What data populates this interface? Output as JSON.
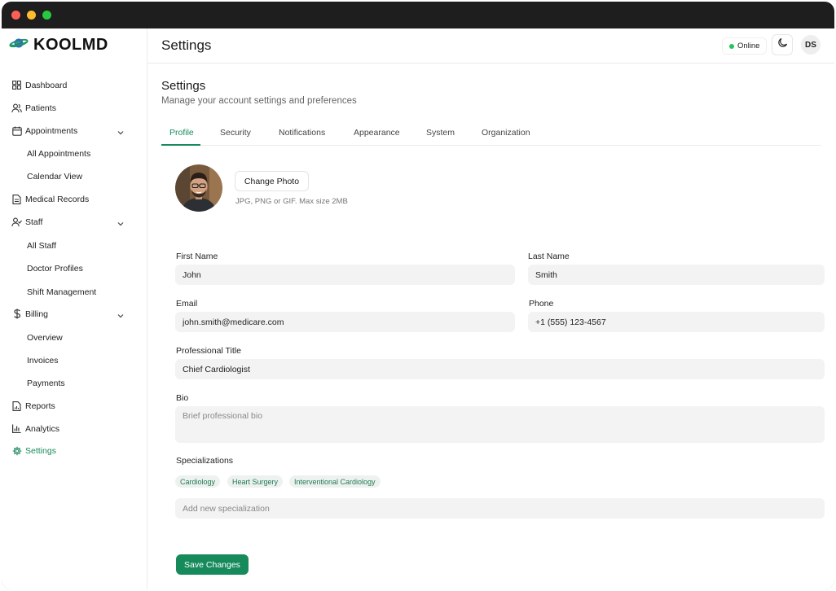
{
  "brand": {
    "name": "KOOLMD",
    "logo_icon": "planet-icon"
  },
  "sidebar": {
    "items": [
      {
        "label": "Dashboard",
        "icon": "grid-icon"
      },
      {
        "label": "Patients",
        "icon": "users-icon"
      },
      {
        "label": "Appointments",
        "icon": "calendar-icon"
      },
      {
        "label": "All Appointments"
      },
      {
        "label": "Calendar View"
      },
      {
        "label": "Medical Records",
        "icon": "document-icon"
      },
      {
        "label": "Staff",
        "icon": "user-check-icon"
      },
      {
        "label": "All Staff"
      },
      {
        "label": "Doctor Profiles"
      },
      {
        "label": "Shift Management"
      },
      {
        "label": "Billing",
        "icon": "dollar-icon"
      },
      {
        "label": "Overview"
      },
      {
        "label": "Invoices"
      },
      {
        "label": "Payments"
      },
      {
        "label": "Reports",
        "icon": "report-icon"
      },
      {
        "label": "Analytics",
        "icon": "bar-chart-icon"
      },
      {
        "label": "Settings",
        "icon": "gear-icon"
      }
    ]
  },
  "header": {
    "title": "Settings",
    "status": "Online",
    "user_initials": "DS"
  },
  "page": {
    "title": "Settings",
    "subtitle": "Manage your account settings and preferences",
    "tabs": [
      "Profile",
      "Security",
      "Notifications",
      "Appearance",
      "System",
      "Organization"
    ],
    "active_tab": "Profile"
  },
  "profile": {
    "change_photo_label": "Change Photo",
    "photo_hint": "JPG, PNG or GIF. Max size 2MB",
    "first_name_label": "First Name",
    "first_name": "John",
    "last_name_label": "Last Name",
    "last_name": "Smith",
    "email_label": "Email",
    "email": "john.smith@medicare.com",
    "phone_label": "Phone",
    "phone": "+1 (555) 123-4567",
    "title_label": "Professional Title",
    "title": "Chief Cardiologist",
    "bio_label": "Bio",
    "bio_placeholder": "Brief professional bio",
    "specializations_label": "Specializations",
    "specializations": [
      "Cardiology",
      "Heart Surgery",
      "Interventional Cardiology"
    ],
    "specialization_placeholder": "Add new specialization",
    "save_label": "Save Changes"
  },
  "colors": {
    "accent": "#168a5b",
    "online": "#22c55e"
  }
}
